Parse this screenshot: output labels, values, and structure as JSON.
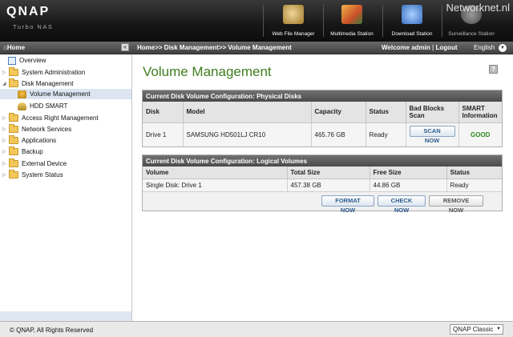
{
  "header": {
    "logo": "QNAP",
    "tagline": "Turbo NAS",
    "watermark": "Networknet.nl",
    "apps": [
      {
        "label": "Web File Manager",
        "icon": "web-file-manager-icon",
        "color": "#c8a04a"
      },
      {
        "label": "Multimedia Station",
        "icon": "multimedia-station-icon",
        "color": "#d8892e"
      },
      {
        "label": "Download Station",
        "icon": "download-station-icon",
        "color": "#5a8cd0"
      },
      {
        "label": "Surveillance Station",
        "icon": "surveillance-station-icon",
        "color": "#8a8a8a"
      }
    ]
  },
  "topbar": {
    "sidebar_home": "Home",
    "breadcrumb": "Home>> Disk Management>> Volume Management",
    "welcome": "Welcome admin",
    "logout": "Logout",
    "language": "English"
  },
  "sidebar": {
    "items": [
      {
        "label": "Overview",
        "icon": "overview-icon"
      },
      {
        "label": "System Administration",
        "icon": "folder-icon"
      },
      {
        "label": "Disk Management",
        "icon": "folder-open-icon"
      },
      {
        "label": "Volume Management",
        "icon": "volume-icon"
      },
      {
        "label": "HDD SMART",
        "icon": "hdd-smart-icon"
      },
      {
        "label": "Access Right Management",
        "icon": "folder-icon"
      },
      {
        "label": "Network Services",
        "icon": "folder-icon"
      },
      {
        "label": "Applications",
        "icon": "folder-icon"
      },
      {
        "label": "Backup",
        "icon": "folder-icon"
      },
      {
        "label": "External Device",
        "icon": "folder-icon"
      },
      {
        "label": "System Status",
        "icon": "folder-icon"
      }
    ]
  },
  "main": {
    "title": "Volume Management",
    "physical": {
      "title": "Current Disk Volume Configuration: Physical Disks",
      "headers": [
        "Disk",
        "Model",
        "Capacity",
        "Status",
        "Bad Blocks Scan",
        "SMART Information"
      ],
      "rows": [
        {
          "disk": "Drive 1",
          "model": "SAMSUNG HD501LJ CR10",
          "capacity": "465.76 GB",
          "status": "Ready",
          "scan_label": "SCAN NOW",
          "smart": "GOOD"
        }
      ]
    },
    "logical": {
      "title": "Current Disk Volume Configuration: Logical Volumes",
      "headers": [
        "Volume",
        "Total Size",
        "Free Size",
        "Status"
      ],
      "rows": [
        {
          "volume": "Single Disk: Drive 1",
          "total": "457.38 GB",
          "free": "44.86 GB",
          "status": "Ready"
        }
      ],
      "buttons": {
        "format": "FORMAT NOW",
        "check": "CHECK NOW",
        "remove": "REMOVE NOW"
      }
    }
  },
  "footer": {
    "copyright": "© QNAP, All Rights Reserved",
    "theme": "QNAP Classic"
  },
  "colors": {
    "title_green": "#3e7e1e",
    "good_green": "#2c8c1a",
    "button_blue": "#2d5b8e"
  }
}
